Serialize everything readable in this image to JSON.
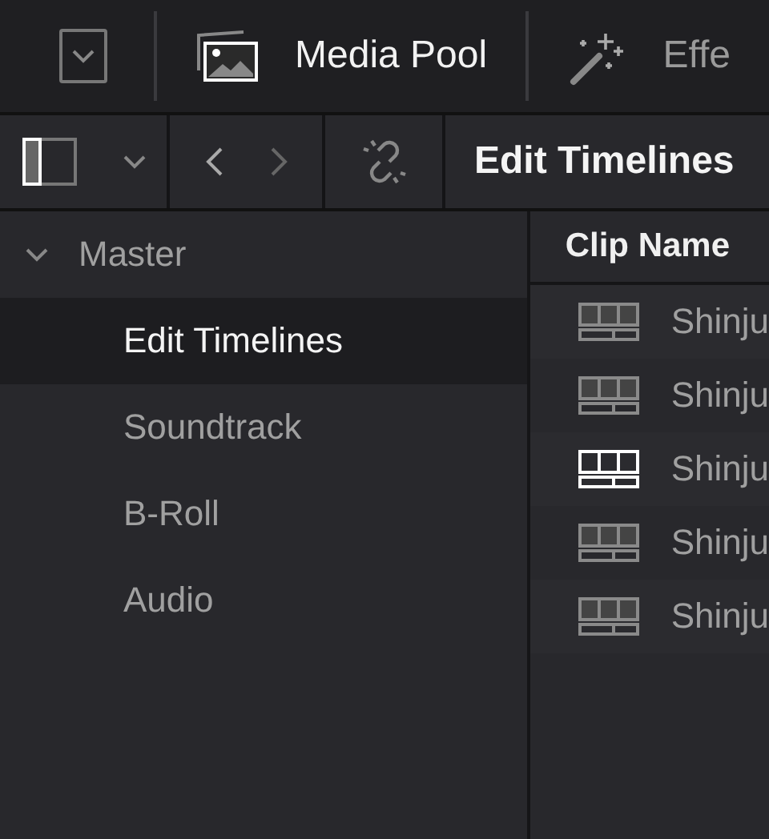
{
  "toolbar": {
    "tabs": [
      {
        "kind": "media",
        "label": "Media Pool",
        "selected": true
      },
      {
        "kind": "effects",
        "label": "Effe",
        "selected": false
      }
    ]
  },
  "nav_bar": {
    "title": "Edit Timelines"
  },
  "sidebar": {
    "items": [
      {
        "label": "Master",
        "expanded": true,
        "selected": false,
        "children": [
          {
            "label": "Edit Timelines",
            "selected": true
          },
          {
            "label": "Soundtrack",
            "selected": false
          },
          {
            "label": "B-Roll",
            "selected": false
          },
          {
            "label": "Audio",
            "selected": false
          }
        ]
      }
    ]
  },
  "table": {
    "columns": [
      "Clip Name"
    ],
    "rows": [
      {
        "name": "Shinju",
        "active": false
      },
      {
        "name": "Shinju",
        "active": false
      },
      {
        "name": "Shinju",
        "active": true
      },
      {
        "name": "Shinju",
        "active": false
      },
      {
        "name": "Shinju",
        "active": false
      }
    ]
  }
}
